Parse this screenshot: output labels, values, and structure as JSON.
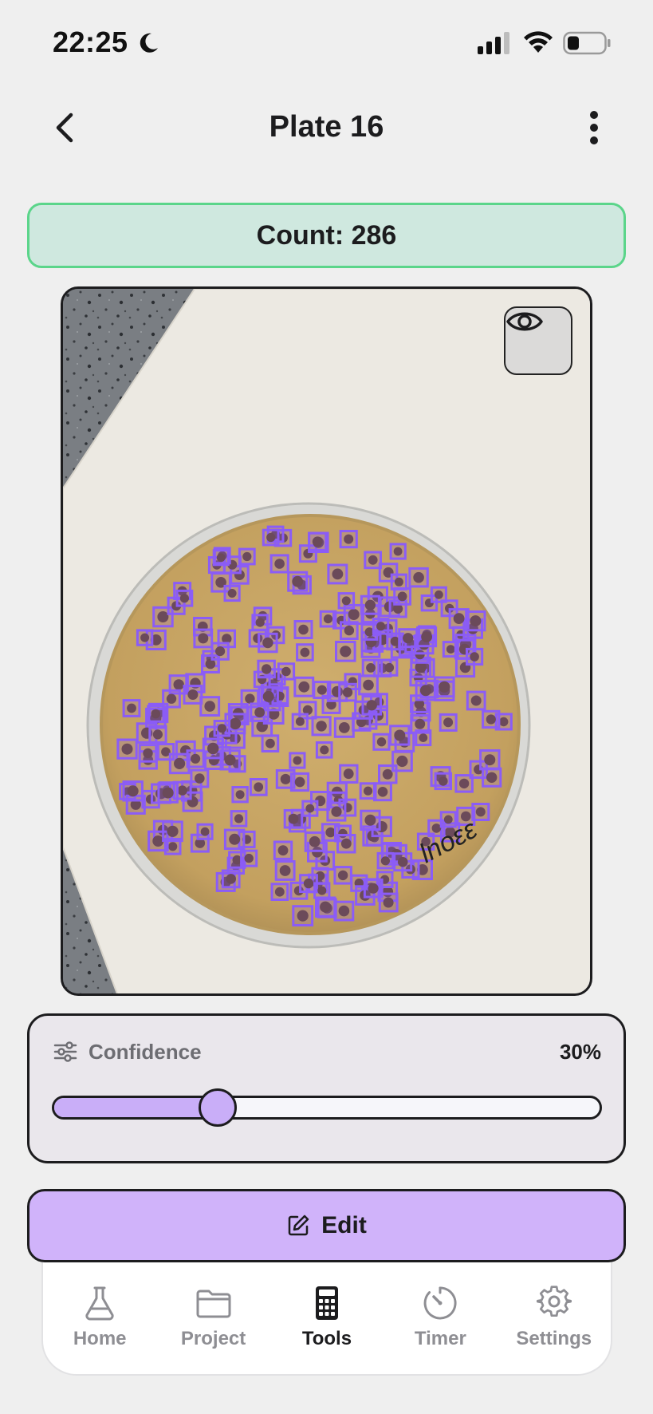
{
  "status_bar": {
    "time": "22:25"
  },
  "header": {
    "title": "Plate 16"
  },
  "count_banner": {
    "label": "Count: 286"
  },
  "confidence": {
    "label": "Confidence",
    "value_text": "30%",
    "value": 0.3
  },
  "edit_button": {
    "label": "Edit"
  },
  "tab_bar": {
    "items": [
      {
        "label": "Home",
        "icon": "flask-icon"
      },
      {
        "label": "Project",
        "icon": "folder-icon"
      },
      {
        "label": "Tools",
        "icon": "calculator-icon",
        "active": true
      },
      {
        "label": "Timer",
        "icon": "timer-icon"
      },
      {
        "label": "Settings",
        "icon": "gear-icon"
      }
    ]
  },
  "colors": {
    "accent": "#c9aef8",
    "banner_bg": "#cfe8df",
    "banner_border": "#5bd58a",
    "detection_box": "#8b5cf6"
  }
}
